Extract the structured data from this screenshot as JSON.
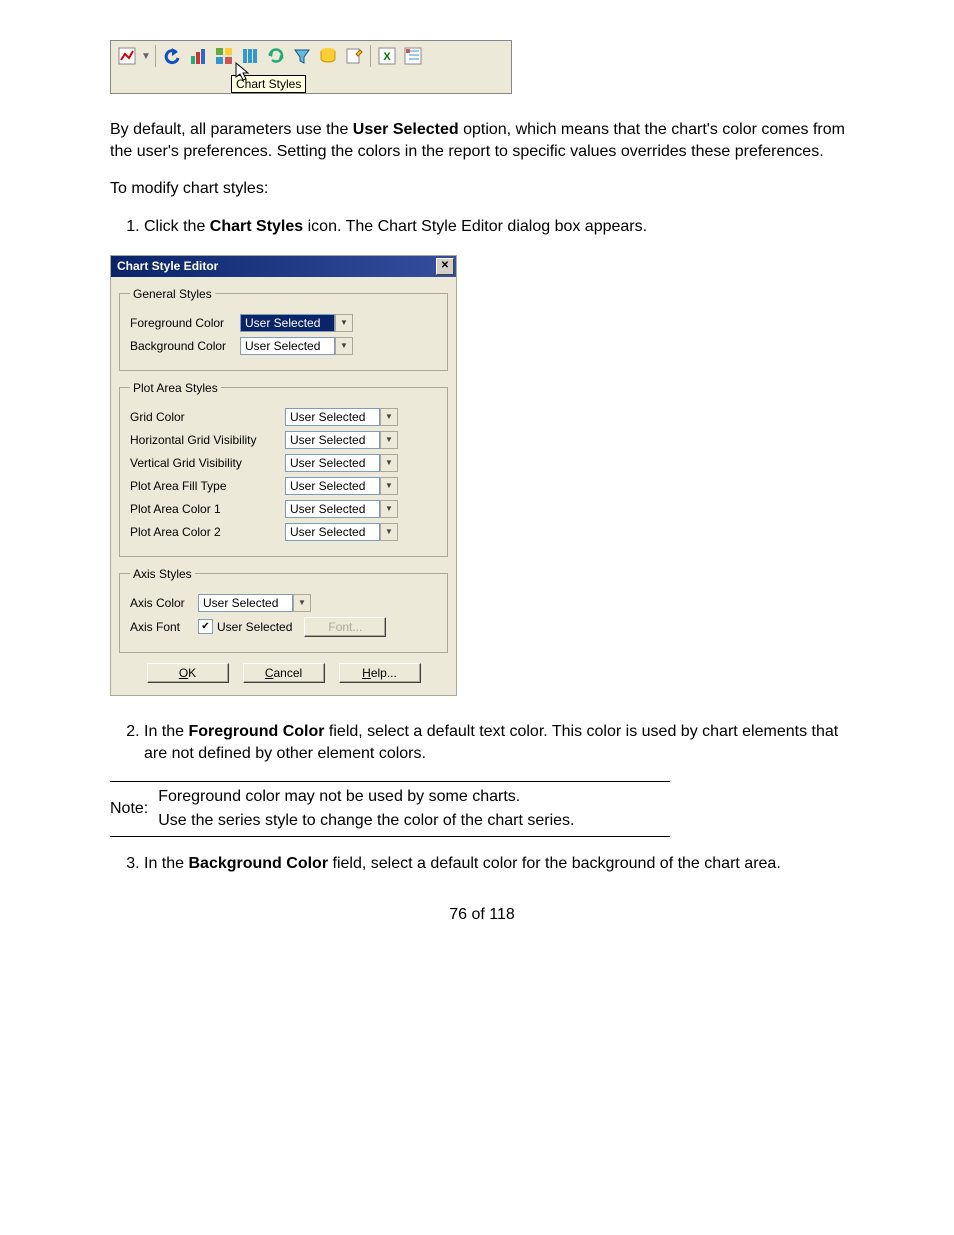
{
  "toolbar": {
    "tooltip": "Chart Styles"
  },
  "para1": {
    "t1": "By default, all parameters use the ",
    "bold1": "User Selected",
    "t2": " option, which means that the chart's color comes from the user's preferences. Setting the colors in the report to specific values overrides these preferences."
  },
  "para2": "To modify chart styles:",
  "step1": {
    "t1": "Click the ",
    "bold1": "Chart Styles",
    "t2": " icon. The Chart Style Editor dialog box appears."
  },
  "dialog": {
    "title": "Chart Style Editor",
    "groups": {
      "general": {
        "legend": "General Styles",
        "fg_label": "Foreground Color",
        "fg_value": "User Selected",
        "bg_label": "Background Color",
        "bg_value": "User Selected"
      },
      "plot": {
        "legend": "Plot Area Styles",
        "grid_label": "Grid Color",
        "grid_value": "User Selected",
        "hgrid_label": "Horizontal Grid Visibility",
        "hgrid_value": "User Selected",
        "vgrid_label": "Vertical Grid Visibility",
        "vgrid_value": "User Selected",
        "fill_label": "Plot Area Fill Type",
        "fill_value": "User Selected",
        "c1_label": "Plot Area Color 1",
        "c1_value": "User Selected",
        "c2_label": "Plot Area Color 2",
        "c2_value": "User Selected"
      },
      "axis": {
        "legend": "Axis Styles",
        "color_label": "Axis Color",
        "color_value": "User Selected",
        "font_label": "Axis Font",
        "font_check_label": "User Selected",
        "font_btn": "Font..."
      }
    },
    "buttons": {
      "ok": "OK",
      "cancel": "Cancel",
      "help": "Help..."
    }
  },
  "step2": {
    "t1": "In the ",
    "bold1": "Foreground Color",
    "t2": " field, select a default text color. This color is used by chart elements that are not defined by other element colors."
  },
  "note": {
    "label": "Note:",
    "line1": "Foreground color may not be used by some charts.",
    "line2": "Use the series style to change the color of the chart series."
  },
  "step3": {
    "t1": "In the ",
    "bold1": "Background Color",
    "t2": " field, select a default color for the background of the chart area."
  },
  "pagenum": "76 of 118"
}
